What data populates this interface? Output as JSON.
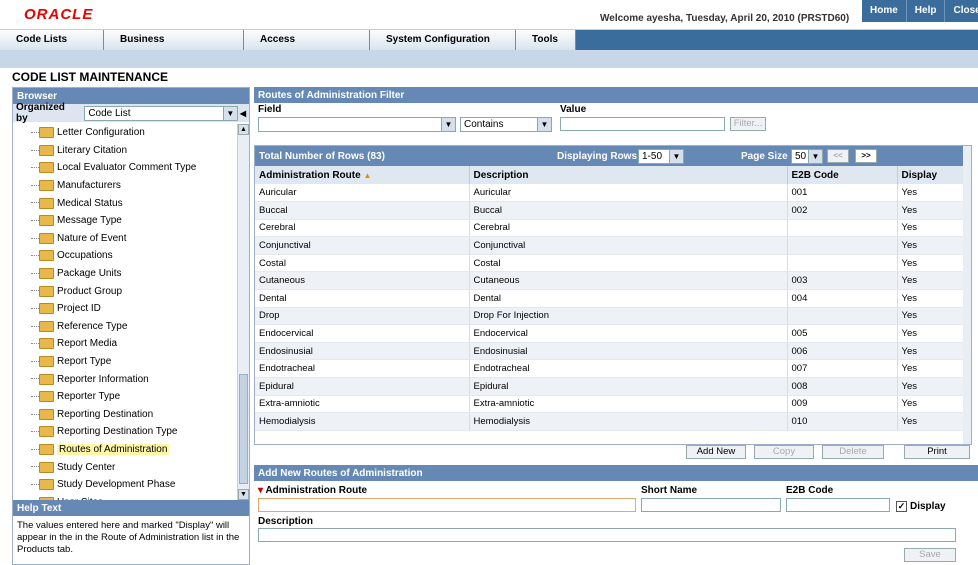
{
  "header": {
    "logo": "ORACLE",
    "welcome": "Welcome ayesha, Tuesday, April 20, 2010 (PRSTD60)",
    "links": [
      "Home",
      "Help",
      "Close"
    ]
  },
  "menu": [
    "Code Lists",
    "Business Configuration",
    "Access Management",
    "System Configuration",
    "Tools"
  ],
  "page_title": "CODE LIST MAINTENANCE",
  "browser": {
    "title": "Browser",
    "organized_label": "Organized by",
    "organized_value": "Code List",
    "items": [
      "Letter Configuration",
      "Literary Citation",
      "Local Evaluator Comment Type",
      "Manufacturers",
      "Medical Status",
      "Message Type",
      "Nature of Event",
      "Occupations",
      "Package Units",
      "Product Group",
      "Project ID",
      "Reference Type",
      "Report Media",
      "Report Type",
      "Reporter Information",
      "Reporter Type",
      "Reporting Destination",
      "Reporting Destination Type",
      "Routes of Administration",
      "Study Center",
      "Study Development Phase",
      "User Sites"
    ],
    "selected": "Routes of Administration"
  },
  "help": {
    "title": "Help Text",
    "text": "The values entered here and marked \"Display\" will appear in the in the Route of Administration list in the Products tab."
  },
  "filter": {
    "title": "Routes of Administration Filter",
    "field_label": "Field",
    "field_value": "",
    "operator": "Contains",
    "value_label": "Value",
    "value": "",
    "button": "Filter..."
  },
  "grid": {
    "total": "Total Number of Rows (83)",
    "displaying_label": "Displaying Rows",
    "displaying_value": "1-50",
    "page_size_label": "Page Size",
    "page_size": "50",
    "prev": "<<",
    "next": ">>",
    "columns": [
      "Administration Route",
      "Description",
      "E2B Code",
      "Display"
    ],
    "rows": [
      [
        "Auricular",
        "Auricular",
        "001",
        "Yes"
      ],
      [
        "Buccal",
        "Buccal",
        "002",
        "Yes"
      ],
      [
        "Cerebral",
        "Cerebral",
        "",
        "Yes"
      ],
      [
        "Conjunctival",
        "Conjunctival",
        "",
        "Yes"
      ],
      [
        "Costal",
        "Costal",
        "",
        "Yes"
      ],
      [
        "Cutaneous",
        "Cutaneous",
        "003",
        "Yes"
      ],
      [
        "Dental",
        "Dental",
        "004",
        "Yes"
      ],
      [
        "Drop",
        "Drop For Injection",
        "",
        "Yes"
      ],
      [
        "Endocervical",
        "Endocervical",
        "005",
        "Yes"
      ],
      [
        "Endosinusial",
        "Endosinusial",
        "006",
        "Yes"
      ],
      [
        "Endotracheal",
        "Endotracheal",
        "007",
        "Yes"
      ],
      [
        "Epidural",
        "Epidural",
        "008",
        "Yes"
      ],
      [
        "Extra-amniotic",
        "Extra-amniotic",
        "009",
        "Yes"
      ],
      [
        "Hemodialysis",
        "Hemodialysis",
        "010",
        "Yes"
      ]
    ],
    "buttons": [
      "Add New",
      "Copy",
      "Delete",
      "Print"
    ]
  },
  "add": {
    "title": "Add New Routes of Administration",
    "route_label": "Administration Route",
    "short_label": "Short Name",
    "e2b_label": "E2B Code",
    "display_label": "Display",
    "desc_label": "Description",
    "save": "Save"
  }
}
